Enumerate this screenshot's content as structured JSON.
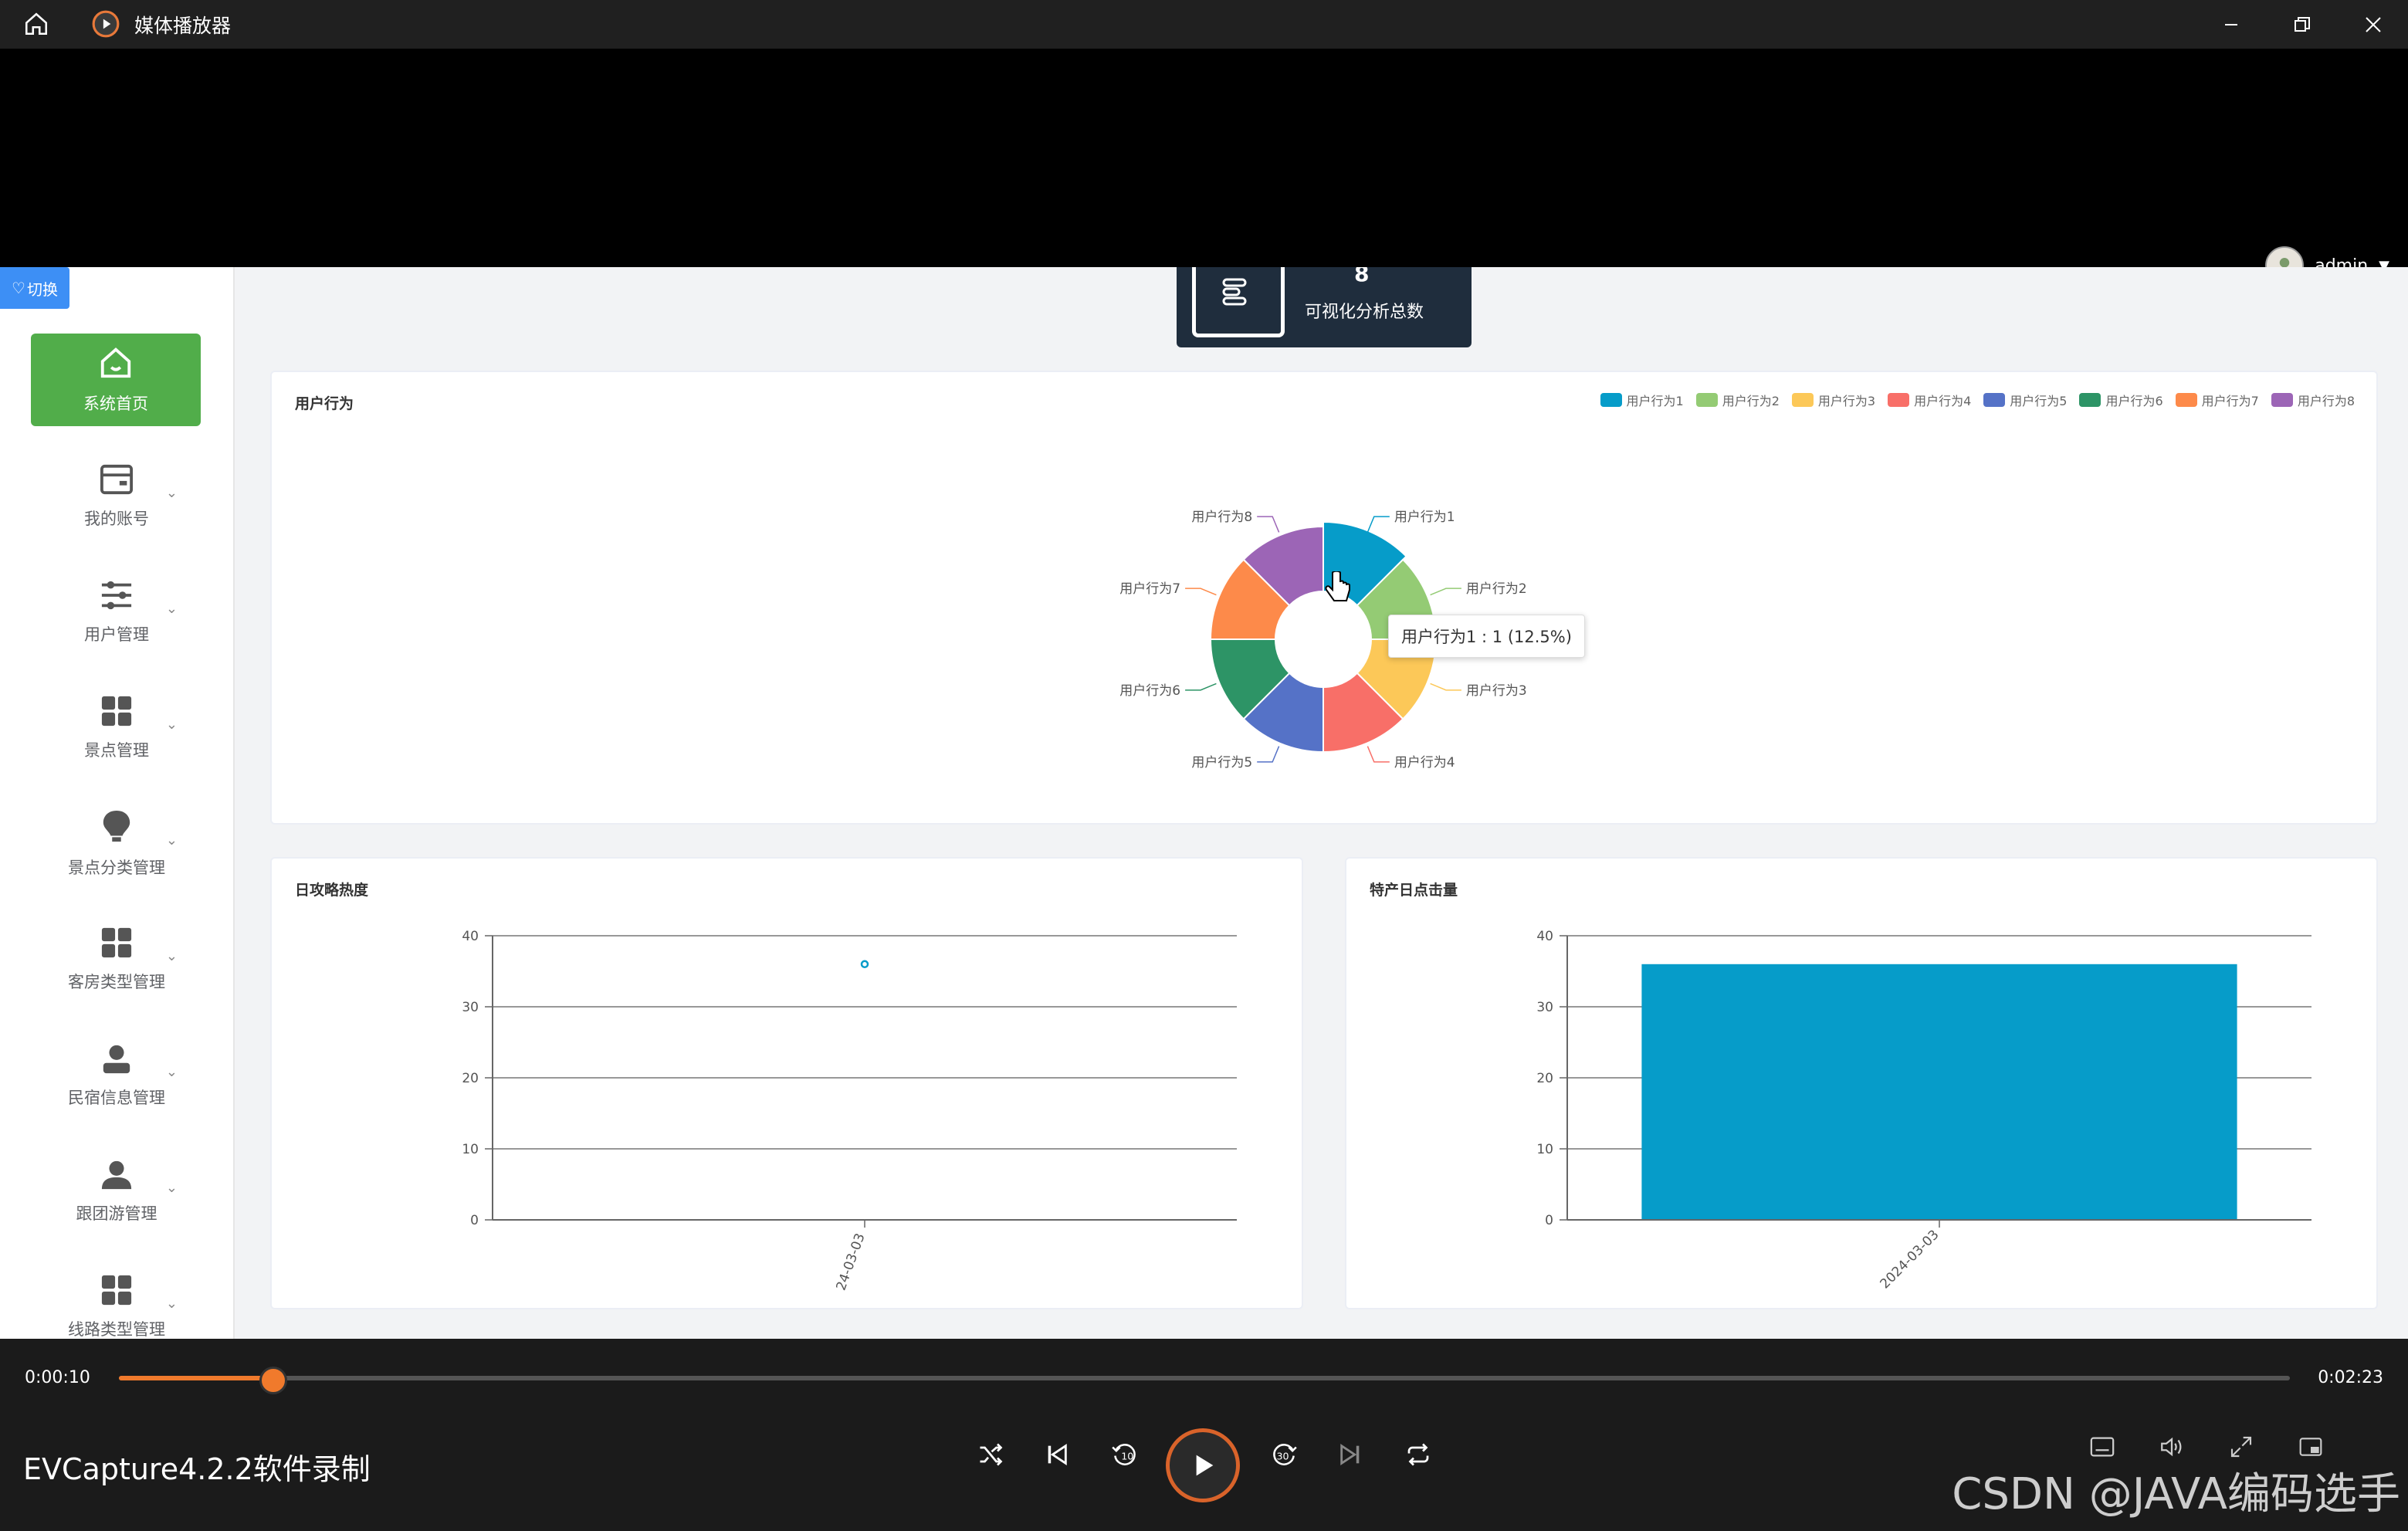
{
  "window": {
    "title": "媒体播放器",
    "user": "admin"
  },
  "sidebar": {
    "switch_label": "切换",
    "items": [
      {
        "label": "系统首页",
        "icon": "home-icon"
      },
      {
        "label": "我的账号",
        "icon": "card-icon"
      },
      {
        "label": "用户管理",
        "icon": "sliders-icon"
      },
      {
        "label": "景点管理",
        "icon": "grid-icon"
      },
      {
        "label": "景点分类管理",
        "icon": "bulb-icon"
      },
      {
        "label": "客房类型管理",
        "icon": "grid-icon"
      },
      {
        "label": "民宿信息管理",
        "icon": "user-icon"
      },
      {
        "label": "跟团游管理",
        "icon": "user-icon"
      },
      {
        "label": "线路类型管理",
        "icon": "grid-icon"
      }
    ]
  },
  "stat": {
    "value": "8",
    "label": "可视化分析总数"
  },
  "pie": {
    "title": "用户行为",
    "tooltip": "用户行为1 : 1 (12.5%)"
  },
  "line_card": {
    "title": "日攻略热度"
  },
  "bar_card": {
    "title": "特产日点击量"
  },
  "chart_data": [
    {
      "type": "pie",
      "title": "用户行为",
      "categories": [
        "用户行为1",
        "用户行为2",
        "用户行为3",
        "用户行为4",
        "用户行为5",
        "用户行为6",
        "用户行为7",
        "用户行为8"
      ],
      "values": [
        1,
        1,
        1,
        1,
        1,
        1,
        1,
        1
      ],
      "colors": [
        "#069cc9",
        "#94cb74",
        "#fcc858",
        "#f86f68",
        "#5572c7",
        "#2d9466",
        "#fd8a4a",
        "#9c65b6"
      ],
      "legend": "top-right"
    },
    {
      "type": "scatter",
      "title": "日攻略热度",
      "categories": [
        "2024-03-03"
      ],
      "tick_label": "24-03-03",
      "values": [
        36
      ],
      "ylim": [
        0,
        40
      ],
      "yticks": [
        0,
        10,
        20,
        30,
        40
      ],
      "color": "#069cc9"
    },
    {
      "type": "bar",
      "title": "特产日点击量",
      "categories": [
        "2024-03-03"
      ],
      "values": [
        36
      ],
      "ylim": [
        0,
        40
      ],
      "yticks": [
        0,
        10,
        20,
        30,
        40
      ],
      "color": "#069cc9"
    }
  ],
  "player": {
    "current_time": "0:00:10",
    "total_time": "0:02:23",
    "progress": 0.07,
    "recorder_text": "EVCapture4.2.2软件录制",
    "watermark": "CSDN @JAVA编码选手"
  }
}
